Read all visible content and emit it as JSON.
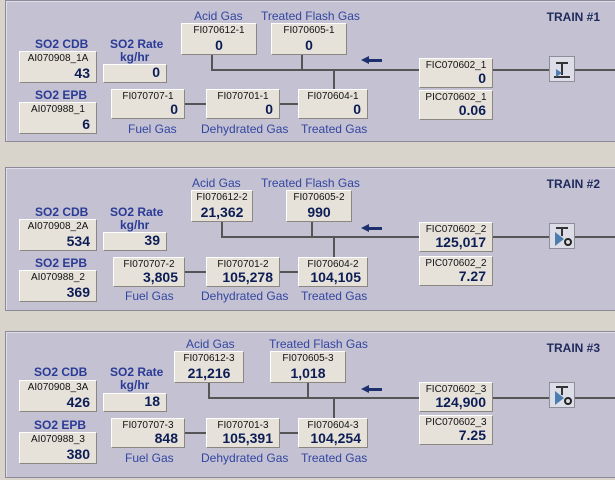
{
  "trains": [
    {
      "title": "TRAIN #1",
      "acid_gas_label": "Acid Gas",
      "treated_flash_label": "Treated Flash Gas",
      "so2_cdb_label": "SO2 CDB",
      "so2_rate_label": "SO2 Rate",
      "so2_rate_unit": "kg/hr",
      "so2_epb_label": "SO2 EPB",
      "fuel_gas_label": "Fuel Gas",
      "dehydrated_label": "Dehydrated Gas",
      "treated_gas_label": "Treated Gas",
      "so2_cdb": {
        "tag": "AI070908_1A",
        "value": "43"
      },
      "so2_rate": {
        "value": "0"
      },
      "so2_epb": {
        "tag": "AI070988_1",
        "value": "6"
      },
      "acid_gas": {
        "tag": "FI070612-1",
        "value": "0"
      },
      "treated_flash": {
        "tag": "FI070605-1",
        "value": "0"
      },
      "fuel_gas": {
        "tag": "FI070707-1",
        "value": "0"
      },
      "dehydrated": {
        "tag": "FI070701-1",
        "value": "0"
      },
      "treated_gas": {
        "tag": "FI070604-1",
        "value": "0"
      },
      "fic": {
        "tag": "FIC070602_1",
        "value": "0"
      },
      "pic": {
        "tag": "PIC070602_1",
        "value": "0.06"
      }
    },
    {
      "title": "TRAIN #2",
      "acid_gas_label": "Acid Gas",
      "treated_flash_label": "Treated Flash Gas",
      "so2_cdb_label": "SO2 CDB",
      "so2_rate_label": "SO2 Rate",
      "so2_rate_unit": "kg/hr",
      "so2_epb_label": "SO2 EPB",
      "fuel_gas_label": "Fuel Gas",
      "dehydrated_label": "Dehydrated Gas",
      "treated_gas_label": "Treated Gas",
      "so2_cdb": {
        "tag": "AI070908_2A",
        "value": "534"
      },
      "so2_rate": {
        "value": "39"
      },
      "so2_epb": {
        "tag": "AI070988_2",
        "value": "369"
      },
      "acid_gas": {
        "tag": "FI070612-2",
        "value": "21,362"
      },
      "treated_flash": {
        "tag": "FI070605-2",
        "value": "990"
      },
      "fuel_gas": {
        "tag": "FI070707-2",
        "value": "3,805"
      },
      "dehydrated": {
        "tag": "FI070701-2",
        "value": "105,278"
      },
      "treated_gas": {
        "tag": "FI070604-2",
        "value": "104,105"
      },
      "fic": {
        "tag": "FIC070602_2",
        "value": "125,017"
      },
      "pic": {
        "tag": "PIC070602_2",
        "value": "7.27"
      }
    },
    {
      "title": "TRAIN #3",
      "acid_gas_label": "Acid Gas",
      "treated_flash_label": "Treated Flash Gas",
      "so2_cdb_label": "SO2 CDB",
      "so2_rate_label": "SO2 Rate",
      "so2_rate_unit": "kg/hr",
      "so2_epb_label": "SO2 EPB",
      "fuel_gas_label": "Fuel Gas",
      "dehydrated_label": "Dehydrated Gas",
      "treated_gas_label": "Treated Gas",
      "so2_cdb": {
        "tag": "AI070908_3A",
        "value": "426"
      },
      "so2_rate": {
        "value": "18"
      },
      "so2_epb": {
        "tag": "AI070988_3",
        "value": "380"
      },
      "acid_gas": {
        "tag": "FI070612-3",
        "value": "21,216"
      },
      "treated_flash": {
        "tag": "FI070605-3",
        "value": "1,018"
      },
      "fuel_gas": {
        "tag": "FI070707-3",
        "value": "848"
      },
      "dehydrated": {
        "tag": "FI070701-3",
        "value": "105,391"
      },
      "treated_gas": {
        "tag": "FI070604-3",
        "value": "104,254"
      },
      "fic": {
        "tag": "FIC070602_3",
        "value": "124,900"
      },
      "pic": {
        "tag": "PIC070602_3",
        "value": "7.25"
      }
    }
  ]
}
